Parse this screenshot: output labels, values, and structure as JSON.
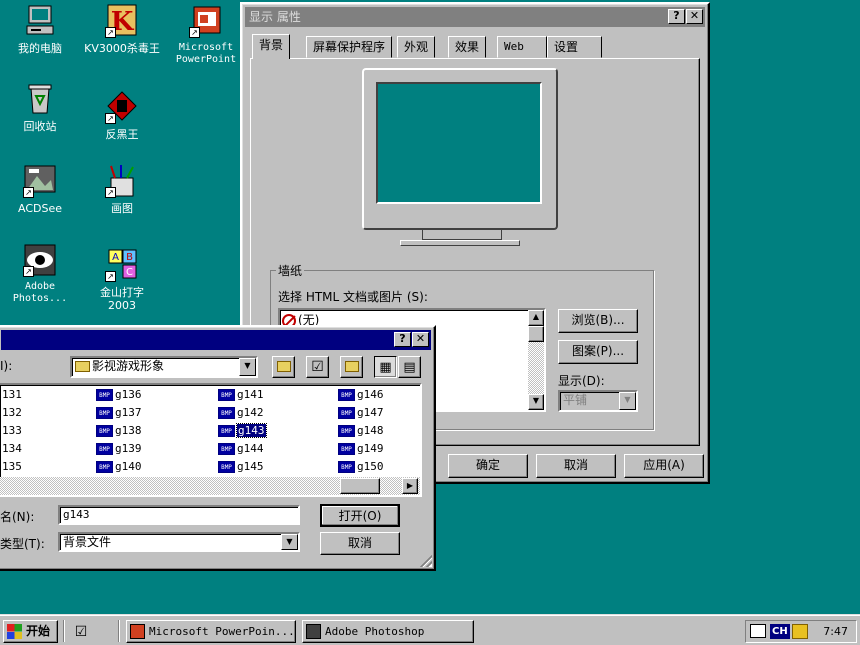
{
  "desktop": {
    "icons": [
      {
        "label": "我的电脑"
      },
      {
        "label": "KV3000杀毒王"
      },
      {
        "label": "Microsoft\nPowerPoint"
      },
      {
        "label": "回收站"
      },
      {
        "label": "反黑王"
      },
      {
        "label": "ACDSee"
      },
      {
        "label": "画图"
      },
      {
        "label": "Adobe\nPhotos..."
      },
      {
        "label": "金山打字\n2003"
      }
    ]
  },
  "display_window": {
    "title": "显示 属性",
    "help_btn": "?",
    "close_btn": "✕",
    "tabs": [
      "背景",
      "屏幕保护程序",
      "外观",
      "效果",
      "Web",
      "设置"
    ],
    "wallpaper_group": "墙纸",
    "select_label": "选择 HTML 文档或图片 (S):",
    "list_item_none": "(无)",
    "browse_btn": "浏览(B)...",
    "pattern_btn": "图案(P)...",
    "display_label": "显示(D):",
    "display_value": "平铺",
    "ok_btn": "确定",
    "cancel_btn": "取消",
    "apply_btn": "应用(A)"
  },
  "file_dialog": {
    "help_btn": "?",
    "close_btn": "✕",
    "lookin_label": "I):",
    "folder": "影视游戏形象",
    "bmp_tag": "BMP",
    "files": [
      [
        "131",
        "132",
        "133",
        "134",
        "135"
      ],
      [
        "g136",
        "g137",
        "g138",
        "g139",
        "g140"
      ],
      [
        "g141",
        "g142",
        "g143",
        "g144",
        "g145"
      ],
      [
        "g146",
        "g147",
        "g148",
        "g149",
        "g150"
      ]
    ],
    "filename_label": "名(N):",
    "filename_value": "g143",
    "filetype_label": "类型(T):",
    "filetype_value": "背景文件",
    "open_btn": "打开(O)",
    "cancel_btn": "取消"
  },
  "taskbar": {
    "start": "开始",
    "items": [
      "Microsoft PowerPoin...",
      "Adobe Photoshop"
    ],
    "tray_lang": "CH",
    "time": "7:47"
  },
  "colors": {
    "desktop": "#008080",
    "title_active": "#000080",
    "title_inactive": "#808080",
    "selection": "#000080"
  }
}
